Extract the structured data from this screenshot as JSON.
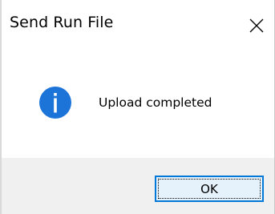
{
  "window": {
    "title": "Send Run File",
    "close_icon": "close-icon"
  },
  "content": {
    "icon": "info-icon",
    "message": "Upload completed"
  },
  "footer": {
    "ok_label": "OK"
  },
  "colors": {
    "accent": "#0078d7",
    "footer_bg": "#f0f0f0",
    "button_bg": "#e5f1fb"
  }
}
